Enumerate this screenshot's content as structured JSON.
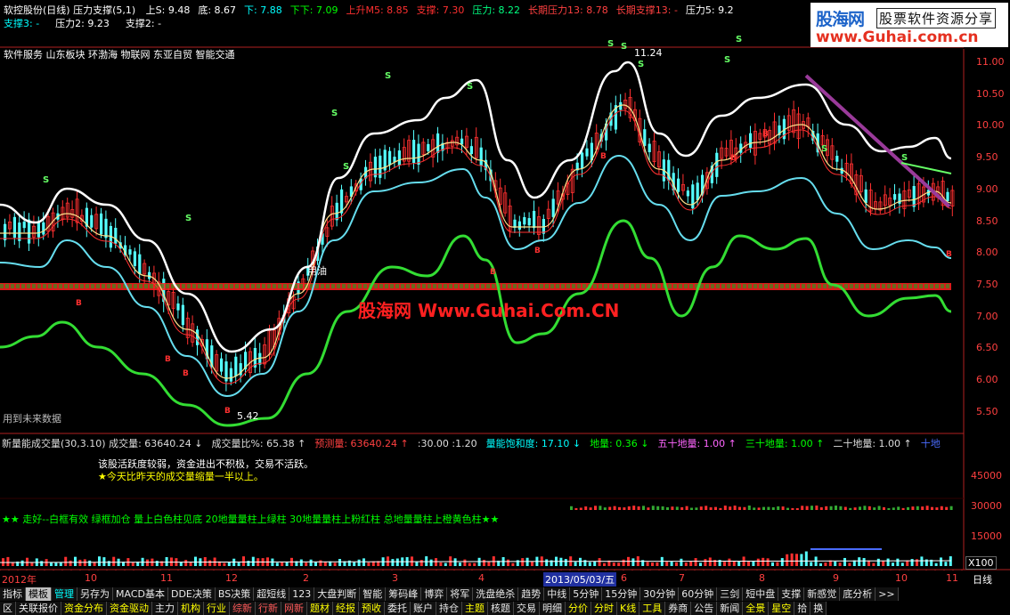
{
  "top_bar": {
    "title": "软控股份(日线) 压力支撑(5,1)",
    "indicators": [
      {
        "label": "上S: 9.48",
        "color": "#ffffff"
      },
      {
        "label": "底: 8.67",
        "color": "#ffffff"
      },
      {
        "label": "下: 7.88",
        "color": "#00ffff"
      },
      {
        "label": "下下: 7.09",
        "color": "#00ff00"
      },
      {
        "label": "上升M5: 8.85",
        "color": "#ff3030"
      },
      {
        "label": "支撑: 7.30",
        "color": "#ff3030"
      },
      {
        "label": "压力: 8.22",
        "color": "#00ff80"
      },
      {
        "label": "长期压力13: 8.78",
        "color": "#ff4040"
      },
      {
        "label": "长期支撑13: -",
        "color": "#ff4040"
      },
      {
        "label": "压力5: 9.2",
        "color": "#ffffff"
      }
    ],
    "row2": [
      {
        "label": "支撑3: -",
        "color": "#00ffff"
      },
      {
        "label": "压力2: 9.23",
        "color": "#ffffff"
      },
      {
        "label": "支撑2: -",
        "color": "#ffffff"
      }
    ]
  },
  "sectors": "软件服务 山东板块 环渤海 物联网 东亚自贸 智能交通",
  "logo": {
    "brand": "股海网",
    "tagline": "股票软件资源分享",
    "url": "www.Guhai.com.cn"
  },
  "watermark": "股海网 Www.Guhai.Com.CN",
  "main_chart": {
    "price_labels": [
      "11.00",
      "10.50",
      "10.00",
      "9.50",
      "9.00",
      "8.50",
      "8.00",
      "7.50",
      "7.00",
      "6.50",
      "6.00",
      "5.50"
    ],
    "annotation_high": "11.24",
    "annotation_low": "5.42",
    "future_data_note": "用到未来数据",
    "annotation_text": "用油"
  },
  "volume_panel": {
    "indicators": [
      {
        "label": "新量能成交量(30,3.10) 成交量: 63640.24 ↓",
        "color": "#dddddd"
      },
      {
        "label": "成交量比%: 65.38 ↑",
        "color": "#dddddd"
      },
      {
        "label": "预测量: 63640.24 ↑",
        "color": "#ff4040"
      },
      {
        "label": ":30.00 :1.20",
        "color": "#dddddd"
      },
      {
        "label": "量能饱和度: 17.10 ↓",
        "color": "#00ffff"
      },
      {
        "label": "地量: 0.36 ↓",
        "color": "#00ff00"
      },
      {
        "label": "五十地量: 1.00 ↑",
        "color": "#ff66ff"
      },
      {
        "label": "三十地量: 1.00 ↑",
        "color": "#00ff00"
      },
      {
        "label": "二十地量: 1.00 ↑",
        "color": "#dddddd"
      },
      {
        "label": "十地",
        "color": "#4a6cff"
      }
    ],
    "messages": [
      "该股活跃度较弱，资金进出不积极，交易不活跃。",
      "★今天比昨天的成交量缩量一半以上。"
    ],
    "legend_note": "★★ 走好--白框有效 绿框加仓 量上白色柱见底 20地量量柱上绿柱 30地量量柱上粉红柱 总地量量柱上橙黄色柱★★",
    "y_labels": [
      "45000",
      "30000",
      "15000"
    ],
    "scale": "X100"
  },
  "date_axis": {
    "labels": [
      "2012年",
      "10",
      "11",
      "12",
      "2",
      "3",
      "4",
      "2013/05/03/五",
      "6",
      "7",
      "8",
      "9",
      "10",
      "11"
    ],
    "period": "日线"
  },
  "tab_row1": [
    "指标",
    "模板",
    "管理",
    "另存为",
    "MACD基本",
    "DDE决策",
    "BS决策",
    "超短线",
    "123",
    "大盘判断",
    "智能",
    "筹码峰",
    "博弈",
    "将军",
    "洗盘绝杀",
    "趋势",
    "中线",
    "5分钟",
    "15分钟",
    "30分钟",
    "60分钟",
    "三剑",
    "短中盘",
    "支撑",
    "新感觉",
    "底分析",
    ">>"
  ],
  "tab_row2": [
    "区",
    "关联报价",
    "资金分布",
    "资金驱动",
    "主力",
    "机构",
    "行业",
    "综新",
    "行新",
    "网新",
    "题材",
    "经报",
    "预收",
    "委托",
    "账户",
    "持仓",
    "主题",
    "核题",
    "交易",
    "明细",
    "分价",
    "分时",
    "K线",
    "工具",
    "券商",
    "公告",
    "新闻",
    "全景",
    "星空",
    "拾",
    "换"
  ],
  "colors": {
    "up": "#ff3030",
    "down": "#54ffff",
    "support_band": "#ff2020",
    "green_line": "#33dd33",
    "white_line": "#ffffff",
    "cyan_line": "#66ddee",
    "purple_line": "#9a3a9a"
  }
}
